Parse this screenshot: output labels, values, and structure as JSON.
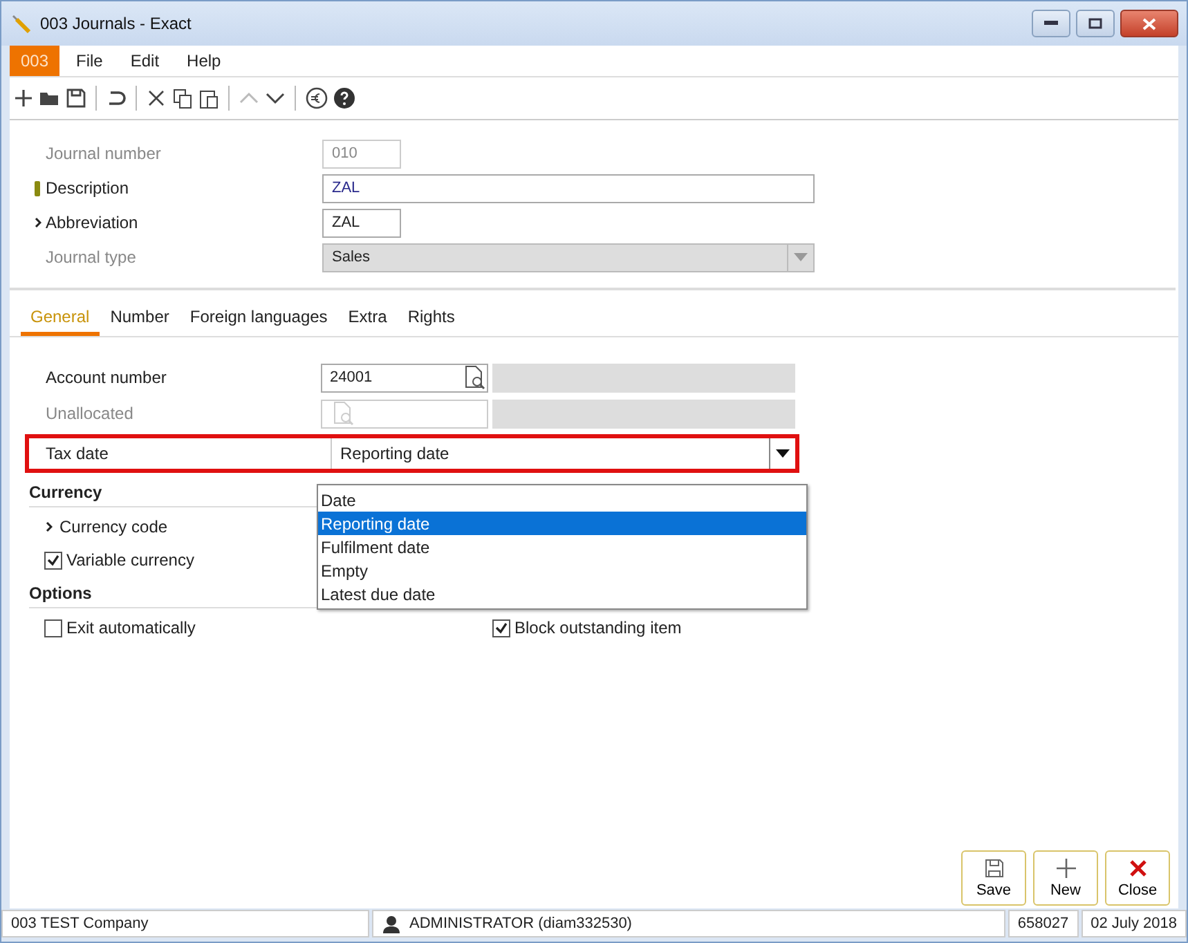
{
  "window": {
    "title": "003 Journals - Exact"
  },
  "menu": {
    "badge": "003",
    "items": [
      "File",
      "Edit",
      "Help"
    ]
  },
  "header_fields": [
    {
      "label": "Journal number",
      "value": "010",
      "kind": "short",
      "disabled": true,
      "required": false,
      "expandable": false
    },
    {
      "label": "Description",
      "value": "ZAL",
      "kind": "wide",
      "disabled": false,
      "required": true,
      "expandable": false
    },
    {
      "label": "Abbreviation",
      "value": "ZAL",
      "kind": "short",
      "disabled": false,
      "required": false,
      "expandable": true
    },
    {
      "label": "Journal type",
      "value": "Sales",
      "kind": "select",
      "disabled": true,
      "required": false,
      "expandable": false
    }
  ],
  "tabs": [
    {
      "label": "General",
      "selected": true
    },
    {
      "label": "Number",
      "selected": false
    },
    {
      "label": "Foreign languages",
      "selected": false
    },
    {
      "label": "Extra",
      "selected": false
    },
    {
      "label": "Rights",
      "selected": false
    }
  ],
  "general": {
    "rows": [
      {
        "label": "Account number",
        "value": "24001",
        "kind": "lookup",
        "disabled": false,
        "highlighted": false
      },
      {
        "label": "Unallocated",
        "kind": "lookup",
        "disabled": true,
        "highlighted": false
      },
      {
        "label": "Tax date",
        "value": "Reporting date",
        "kind": "select",
        "disabled": false,
        "highlighted": true
      }
    ],
    "dropdown": [
      {
        "label": "Date",
        "selected": false
      },
      {
        "label": "Reporting date",
        "selected": true
      },
      {
        "label": "Fulfilment date",
        "selected": false
      },
      {
        "label": "Empty",
        "selected": false
      },
      {
        "label": "Latest due date",
        "selected": false
      }
    ],
    "currency": {
      "title": "Currency",
      "code_label": "Currency code",
      "checkbox": {
        "label": "Variable currency",
        "checked": true
      }
    },
    "options": {
      "title": "Options",
      "checkboxes": [
        {
          "label": "Exit automatically",
          "checked": false
        },
        {
          "label": "Block outstanding item",
          "checked": true
        }
      ]
    }
  },
  "buttons": [
    {
      "label": "Save",
      "kind": "save"
    },
    {
      "label": "New",
      "kind": "new"
    },
    {
      "label": "Close",
      "kind": "close"
    }
  ],
  "status_bar": {
    "company": "003 TEST Company",
    "user": "ADMINISTRATOR (diam332530)",
    "code": "658027",
    "date": "02 July 2018"
  }
}
